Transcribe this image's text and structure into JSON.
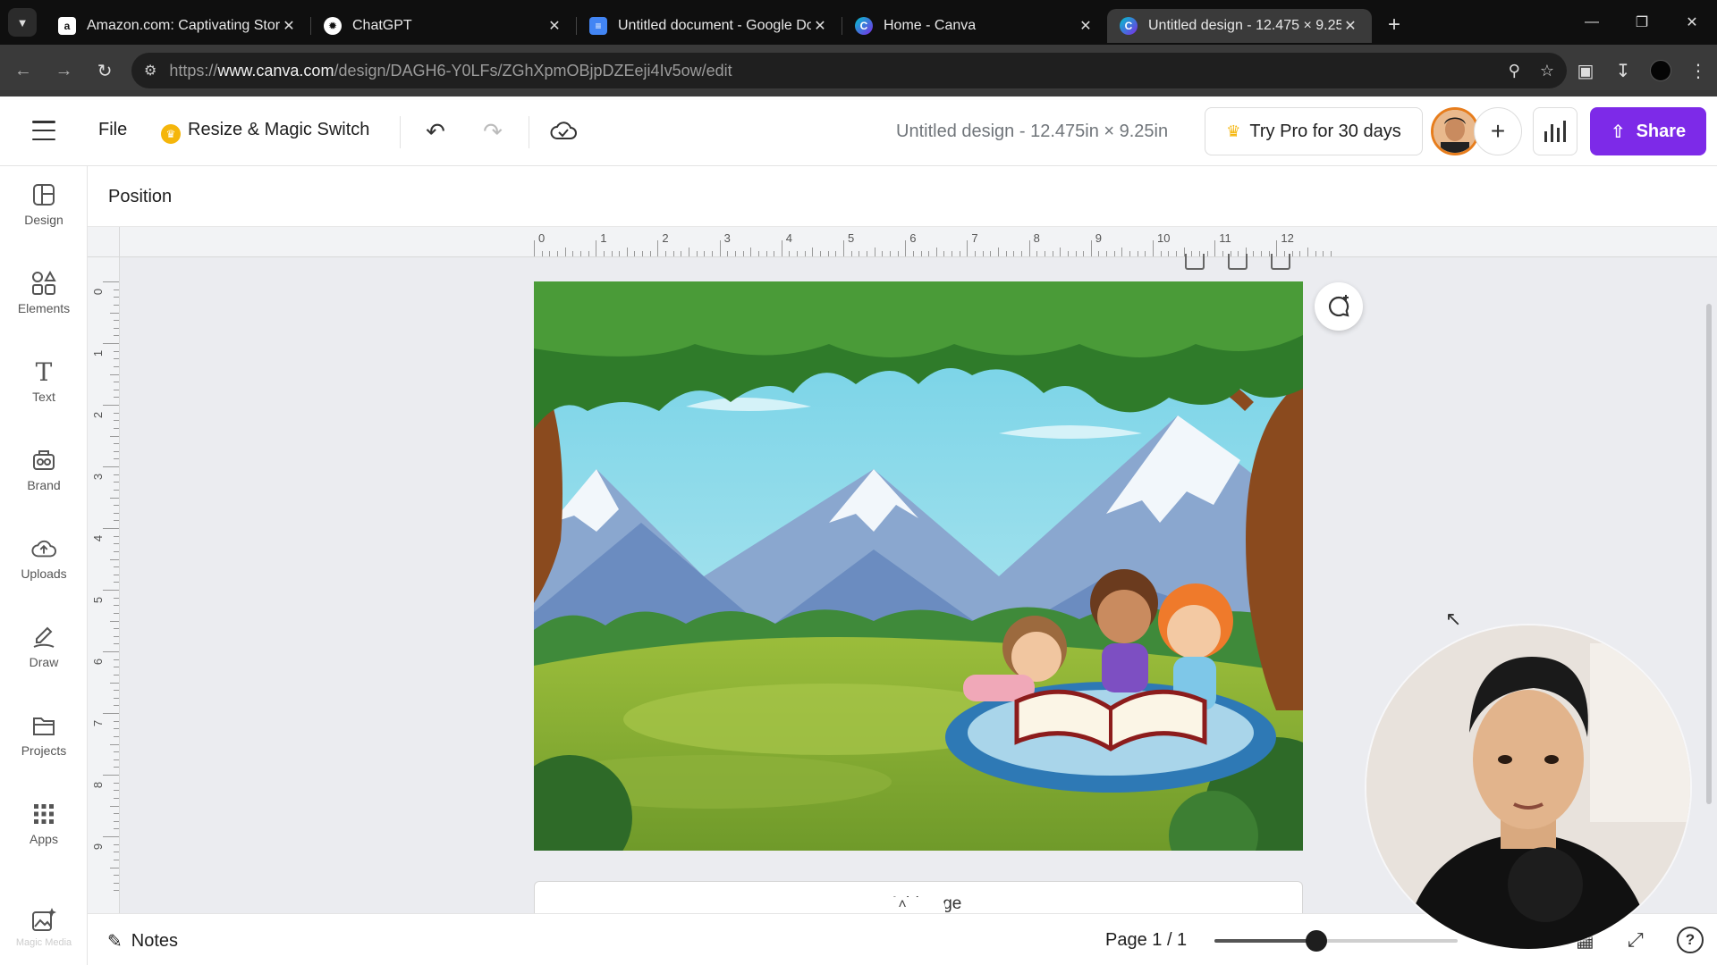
{
  "browser": {
    "tabs": [
      {
        "title": "Amazon.com: Captivating Stori",
        "favicon": "amazon-icon",
        "active": false
      },
      {
        "title": "ChatGPT",
        "favicon": "chatgpt-icon",
        "active": false
      },
      {
        "title": "Untitled document - Google Do",
        "favicon": "google-docs-icon",
        "active": false
      },
      {
        "title": "Home - Canva",
        "favicon": "canva-icon",
        "active": false
      },
      {
        "title": "Untitled design - 12.475 × 9.25i",
        "favicon": "canva-icon",
        "active": true
      }
    ],
    "url_prefix": "https://",
    "url_domain": "www.canva.com",
    "url_path": "/design/DAGH6-Y0LFs/ZGhXpmOBjpDZEeji4Iv5ow/edit"
  },
  "topbar": {
    "file_label": "File",
    "resize_label": "Resize & Magic Switch",
    "design_title": "Untitled design - 12.475in × 9.25in",
    "try_pro_label": "Try Pro for 30 days",
    "share_label": "Share"
  },
  "rail": {
    "items": [
      {
        "label": "Design",
        "icon": "design-icon"
      },
      {
        "label": "Elements",
        "icon": "elements-icon"
      },
      {
        "label": "Text",
        "icon": "text-icon"
      },
      {
        "label": "Brand",
        "icon": "brand-icon"
      },
      {
        "label": "Uploads",
        "icon": "uploads-icon"
      },
      {
        "label": "Draw",
        "icon": "draw-icon"
      },
      {
        "label": "Projects",
        "icon": "projects-icon"
      },
      {
        "label": "Apps",
        "icon": "apps-icon"
      },
      {
        "label": "Magic Media",
        "icon": "magic-media-icon"
      }
    ]
  },
  "position_bar": {
    "label": "Position"
  },
  "ruler": {
    "top": [
      "0",
      "1",
      "2",
      "3",
      "4",
      "5",
      "6",
      "7",
      "8",
      "9",
      "10",
      "11",
      "12"
    ],
    "left": [
      "0",
      "1",
      "2",
      "3",
      "4",
      "5",
      "6",
      "7",
      "8",
      "9"
    ]
  },
  "canvas": {
    "add_page_label": "+ Add page"
  },
  "bottombar": {
    "notes_label": "Notes",
    "page_indicator": "Page 1 / 1",
    "zoom_fraction": 0.42
  },
  "colors": {
    "accent": "#7d2ae8",
    "tab_bg": "#0f0f0f",
    "workspace_bg": "#ebecf0"
  }
}
